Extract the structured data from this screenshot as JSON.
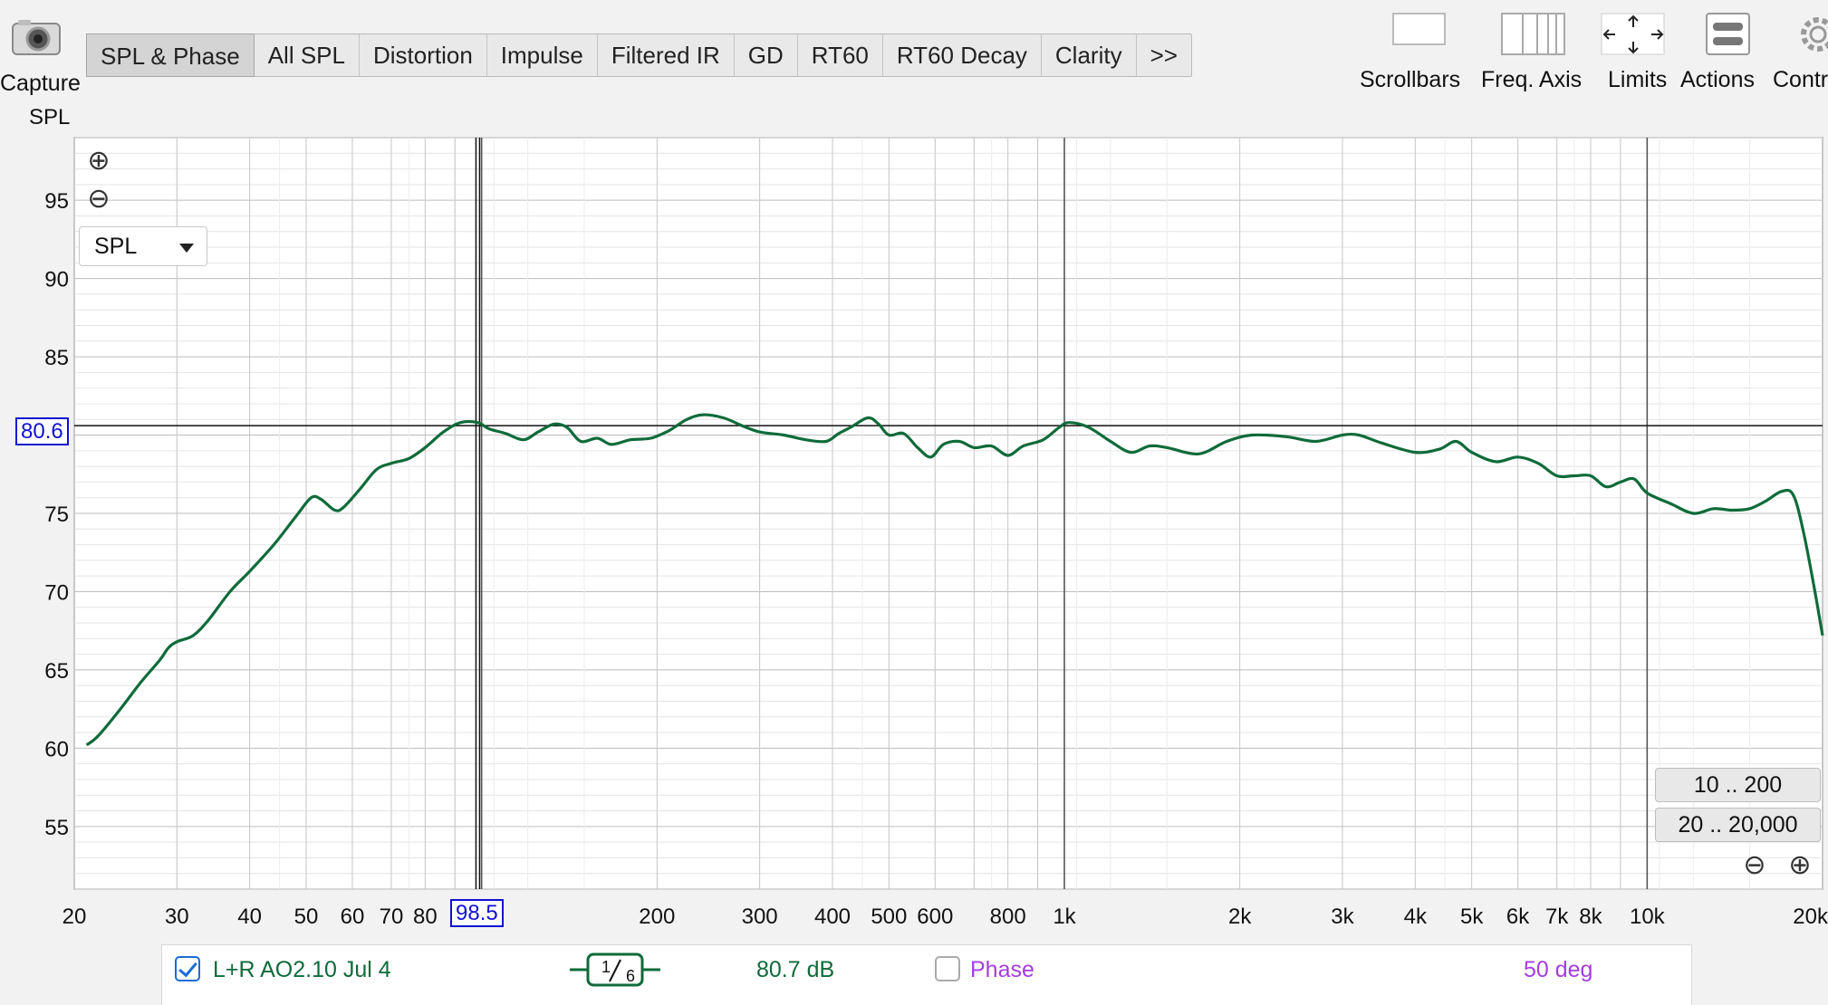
{
  "toolbar": {
    "capture_label": "Capture",
    "tabs": [
      "SPL & Phase",
      "All SPL",
      "Distortion",
      "Impulse",
      "Filtered IR",
      "GD",
      "RT60",
      "RT60 Decay",
      "Clarity",
      ">>"
    ],
    "active_tab": "SPL & Phase",
    "right_tools": {
      "scrollbars": "Scrollbars",
      "freq_axis": "Freq. Axis",
      "limits": "Limits",
      "actions": "Actions",
      "controls": "Contr"
    }
  },
  "plot": {
    "y_axis_title": "SPL",
    "trace_select": "SPL",
    "cursor_y_value": "80.6",
    "cursor_x_value": "98.5",
    "range_buttons": [
      "10 .. 200",
      "20 .. 20,000"
    ],
    "colors": {
      "trace": "#0f6b3a",
      "cursor": "#1010d0",
      "phase": "#a43de0"
    }
  },
  "chart_data": {
    "type": "line",
    "x_scale": "log",
    "xlim": [
      20,
      20000
    ],
    "ylim": [
      51,
      99
    ],
    "grid": true,
    "x_tick_labels": [
      {
        "v": 20,
        "t": "20"
      },
      {
        "v": 30,
        "t": "30"
      },
      {
        "v": 40,
        "t": "40"
      },
      {
        "v": 50,
        "t": "50"
      },
      {
        "v": 60,
        "t": "60"
      },
      {
        "v": 70,
        "t": "70"
      },
      {
        "v": 80,
        "t": "80"
      },
      {
        "v": 200,
        "t": "200"
      },
      {
        "v": 300,
        "t": "300"
      },
      {
        "v": 400,
        "t": "400"
      },
      {
        "v": 500,
        "t": "500"
      },
      {
        "v": 600,
        "t": "600"
      },
      {
        "v": 800,
        "t": "800"
      },
      {
        "v": 1000,
        "t": "1k"
      },
      {
        "v": 2000,
        "t": "2k"
      },
      {
        "v": 3000,
        "t": "3k"
      },
      {
        "v": 4000,
        "t": "4k"
      },
      {
        "v": 5000,
        "t": "5k"
      },
      {
        "v": 6000,
        "t": "6k"
      },
      {
        "v": 7000,
        "t": "7k"
      },
      {
        "v": 8000,
        "t": "8k"
      },
      {
        "v": 10000,
        "t": "10k"
      },
      {
        "v": 20000,
        "t": "20k"
      }
    ],
    "y_ticks": [
      55,
      60,
      65,
      70,
      75,
      80,
      85,
      90,
      95
    ],
    "cursor": {
      "x": 98.5,
      "y": 80.6
    },
    "series": [
      {
        "name": "L+R AO2.10 Jul 4",
        "points": [
          [
            21,
            60.2
          ],
          [
            22,
            60.8
          ],
          [
            24,
            62.5
          ],
          [
            26,
            64.2
          ],
          [
            28,
            65.6
          ],
          [
            29,
            66.4
          ],
          [
            30,
            66.8
          ],
          [
            32,
            67.2
          ],
          [
            34,
            68.2
          ],
          [
            37,
            70.0
          ],
          [
            40,
            71.3
          ],
          [
            44,
            73.0
          ],
          [
            48,
            74.8
          ],
          [
            51,
            76.0
          ],
          [
            53,
            75.9
          ],
          [
            56,
            75.2
          ],
          [
            58,
            75.4
          ],
          [
            62,
            76.6
          ],
          [
            66,
            77.8
          ],
          [
            70,
            78.2
          ],
          [
            75,
            78.5
          ],
          [
            80,
            79.2
          ],
          [
            86,
            80.2
          ],
          [
            92,
            80.8
          ],
          [
            98.5,
            80.8
          ],
          [
            103,
            80.4
          ],
          [
            110,
            80.1
          ],
          [
            118,
            79.7
          ],
          [
            125,
            80.2
          ],
          [
            133,
            80.7
          ],
          [
            140,
            80.5
          ],
          [
            148,
            79.6
          ],
          [
            158,
            79.8
          ],
          [
            167,
            79.4
          ],
          [
            180,
            79.7
          ],
          [
            195,
            79.8
          ],
          [
            210,
            80.3
          ],
          [
            225,
            81.0
          ],
          [
            240,
            81.3
          ],
          [
            260,
            81.1
          ],
          [
            280,
            80.6
          ],
          [
            300,
            80.2
          ],
          [
            330,
            80.0
          ],
          [
            360,
            79.7
          ],
          [
            390,
            79.6
          ],
          [
            410,
            80.1
          ],
          [
            430,
            80.5
          ],
          [
            460,
            81.1
          ],
          [
            480,
            80.7
          ],
          [
            500,
            80.0
          ],
          [
            530,
            80.1
          ],
          [
            560,
            79.2
          ],
          [
            590,
            78.6
          ],
          [
            620,
            79.4
          ],
          [
            660,
            79.6
          ],
          [
            700,
            79.2
          ],
          [
            750,
            79.3
          ],
          [
            800,
            78.7
          ],
          [
            850,
            79.3
          ],
          [
            920,
            79.7
          ],
          [
            980,
            80.5
          ],
          [
            1020,
            80.8
          ],
          [
            1100,
            80.5
          ],
          [
            1200,
            79.6
          ],
          [
            1300,
            78.9
          ],
          [
            1400,
            79.3
          ],
          [
            1500,
            79.2
          ],
          [
            1700,
            78.8
          ],
          [
            1900,
            79.6
          ],
          [
            2100,
            80.0
          ],
          [
            2400,
            79.9
          ],
          [
            2700,
            79.6
          ],
          [
            3000,
            80.0
          ],
          [
            3200,
            80.0
          ],
          [
            3500,
            79.5
          ],
          [
            4000,
            78.9
          ],
          [
            4400,
            79.1
          ],
          [
            4700,
            79.6
          ],
          [
            5000,
            78.9
          ],
          [
            5500,
            78.3
          ],
          [
            6000,
            78.6
          ],
          [
            6500,
            78.2
          ],
          [
            7000,
            77.4
          ],
          [
            7500,
            77.4
          ],
          [
            8000,
            77.4
          ],
          [
            8500,
            76.7
          ],
          [
            9000,
            77.0
          ],
          [
            9500,
            77.2
          ],
          [
            10000,
            76.3
          ],
          [
            11000,
            75.6
          ],
          [
            12000,
            75.0
          ],
          [
            13000,
            75.3
          ],
          [
            14000,
            75.2
          ],
          [
            15000,
            75.3
          ],
          [
            16000,
            75.8
          ],
          [
            17000,
            76.4
          ],
          [
            17800,
            76.2
          ],
          [
            18500,
            74.0
          ],
          [
            19300,
            70.5
          ],
          [
            20000,
            67.2
          ]
        ]
      }
    ]
  },
  "legend": {
    "trace": {
      "name": "L+R AO2.10 Jul 4",
      "smoothing": "1/6",
      "level": "80.7 dB",
      "checked": true
    },
    "phase": {
      "name": "Phase",
      "value": "50 deg",
      "checked": false
    }
  }
}
